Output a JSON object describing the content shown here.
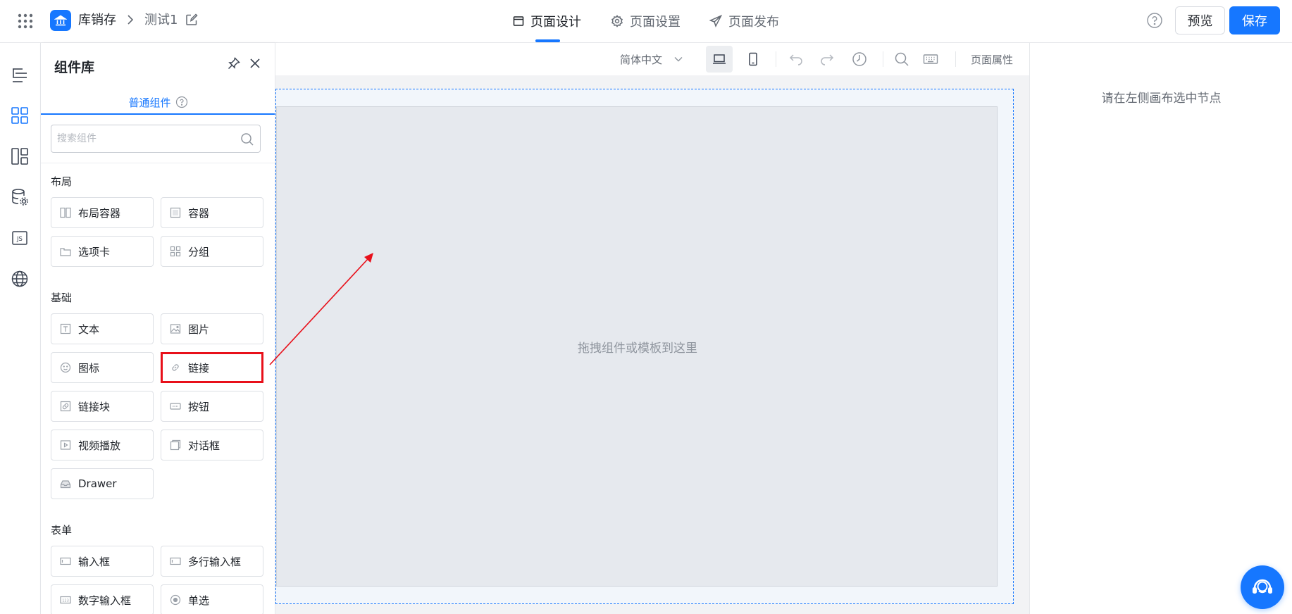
{
  "header": {
    "app_name": "库销存",
    "page_name": "测试1",
    "tabs": [
      {
        "label": "页面设计",
        "active": true
      },
      {
        "label": "页面设置",
        "active": false
      },
      {
        "label": "页面发布",
        "active": false
      }
    ],
    "preview_label": "预览",
    "save_label": "保存"
  },
  "rail": {
    "items": [
      "outline-icon",
      "components-icon",
      "templates-icon",
      "datasource-icon",
      "js-icon",
      "globe-icon"
    ],
    "js_text": "JS"
  },
  "panel": {
    "title": "组件库",
    "tab_label": "普通组件",
    "search_placeholder": "搜索组件",
    "sections": [
      {
        "title": "布局",
        "items": [
          "布局容器",
          "容器",
          "选项卡",
          "分组"
        ]
      },
      {
        "title": "基础",
        "items": [
          "文本",
          "图片",
          "图标",
          "链接",
          "链接块",
          "按钮",
          "视频播放",
          "对话框",
          "Drawer"
        ]
      },
      {
        "title": "表单",
        "items": [
          "输入框",
          "多行输入框",
          "数字输入框",
          "单选"
        ]
      }
    ],
    "highlighted_item": "链接"
  },
  "toolbar": {
    "language": "简体中文",
    "page_attributes_label": "页面属性"
  },
  "canvas": {
    "drop_hint": "拖拽组件或模板到这里"
  },
  "right_panel": {
    "hint": "请在左侧画布选中节点"
  },
  "colors": {
    "accent": "#1677ff",
    "annotation": "#e8101a"
  }
}
